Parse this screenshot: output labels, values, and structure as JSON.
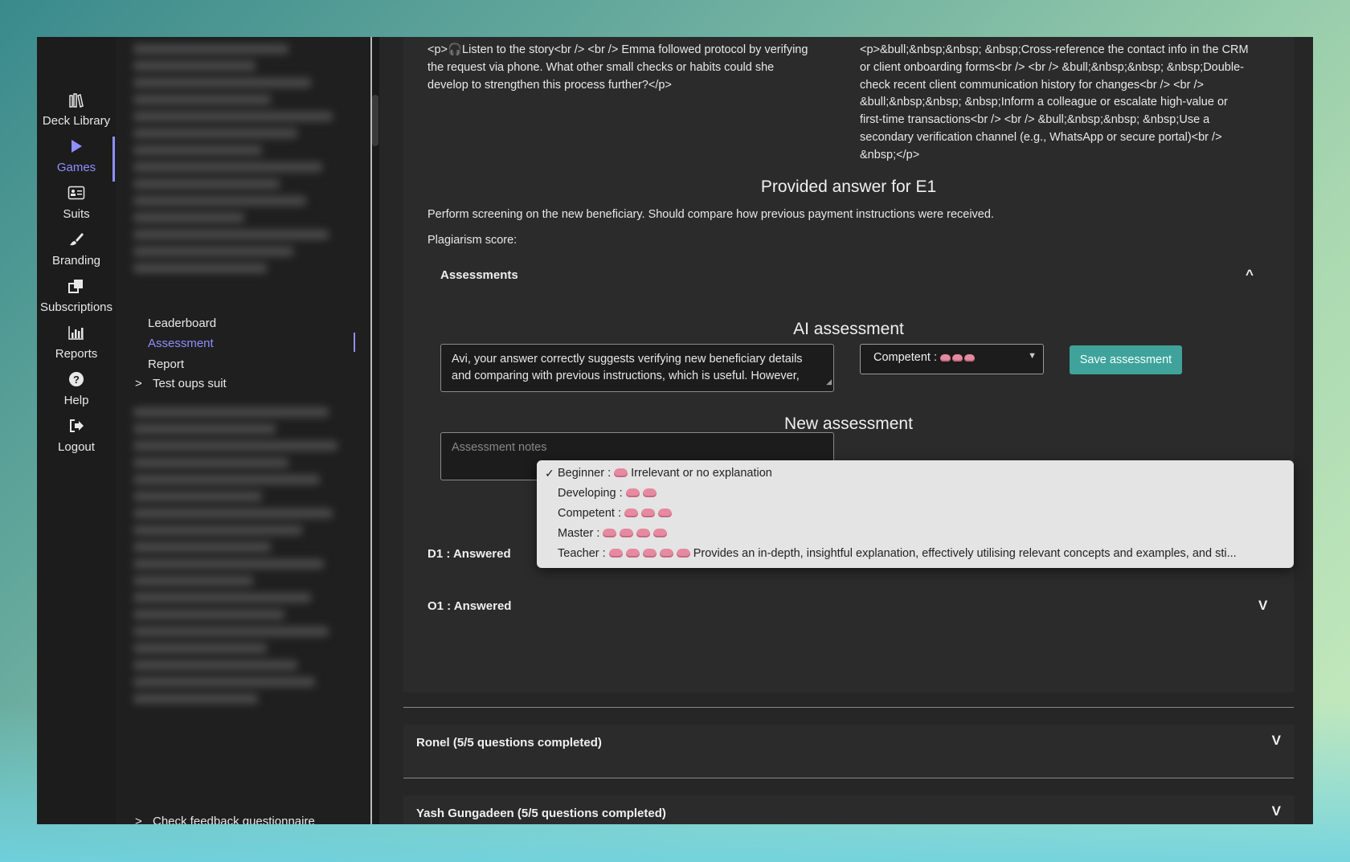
{
  "nav": {
    "items": [
      {
        "label": "Deck Library",
        "icon": "library-icon"
      },
      {
        "label": "Games",
        "icon": "play-icon"
      },
      {
        "label": "Suits",
        "icon": "id-card-icon"
      },
      {
        "label": "Branding",
        "icon": "brush-icon"
      },
      {
        "label": "Subscriptions",
        "icon": "subscriptions-icon"
      },
      {
        "label": "Reports",
        "icon": "bar-chart-icon"
      },
      {
        "label": "Help",
        "icon": "help-icon"
      },
      {
        "label": "Logout",
        "icon": "logout-icon"
      }
    ],
    "active": "Games"
  },
  "tree": {
    "links": [
      "Leaderboard",
      "Assessment",
      "Report"
    ],
    "active": "Assessment",
    "groups": [
      {
        "chevron": ">",
        "label": "Test oups suit"
      },
      {
        "chevron": ">",
        "label": "Check feedback questionnaire"
      }
    ]
  },
  "question": {
    "prompt": "<p>🎧Listen to the story<br /> <br /> Emma followed protocol by verifying the request via phone. What other small checks or habits could she develop to strengthen this process further?</p>",
    "suggested": "<p>&bull;&nbsp;&nbsp; &nbsp;Cross-reference the contact info in the CRM or client onboarding forms<br /> <br /> &bull;&nbsp;&nbsp; &nbsp;Double-check recent client communication history for changes<br /> <br /> &bull;&nbsp;&nbsp; &nbsp;Inform a colleague or escalate high-value or first-time transactions<br /> <br /> &bull;&nbsp;&nbsp; &nbsp;Use a secondary verification channel (e.g., WhatsApp or secure portal)<br /> &nbsp;</p>"
  },
  "answer": {
    "title": "Provided answer for E1",
    "text": "Perform screening on the new beneficiary. Should compare how previous payment instructions were received.",
    "plagiarism_label": "Plagiarism score:"
  },
  "assessments": {
    "header": "Assessments",
    "toggle": "^",
    "ai_title": "AI assessment",
    "ai_text": "Avi, your answer correctly suggests verifying new beneficiary details and comparing with previous instructions, which is useful. However,",
    "ai_level": "Competent :",
    "ai_level_brains": 3,
    "save_label": "Save assessment",
    "new_title": "New assessment",
    "notes_placeholder": "Assessment notes"
  },
  "dropdown": {
    "options": [
      {
        "label": "Beginner :",
        "brains": 1,
        "desc": "Irrelevant or no explanation",
        "checked": true
      },
      {
        "label": "Developing :",
        "brains": 2,
        "desc": "",
        "checked": false
      },
      {
        "label": "Competent :",
        "brains": 3,
        "desc": "",
        "checked": false
      },
      {
        "label": "Master :",
        "brains": 4,
        "desc": "",
        "checked": false
      },
      {
        "label": "Teacher :",
        "brains": 5,
        "desc": "Provides an in-depth, insightful explanation, effectively utilising relevant concepts and examples, and sti...",
        "checked": false
      }
    ],
    "check": "✓"
  },
  "rows": [
    {
      "label": "D1 : Answered",
      "toggle": "V"
    },
    {
      "label": "O1 : Answered",
      "toggle": "V"
    }
  ],
  "students": [
    {
      "label": "Ronel (5/5 questions completed)",
      "toggle": "V"
    },
    {
      "label": "Yash Gungadeen (5/5 questions completed)",
      "toggle": "V"
    }
  ],
  "colors": {
    "accent": "#8f8fff",
    "button": "#3fa39c",
    "panel": "#262626"
  }
}
